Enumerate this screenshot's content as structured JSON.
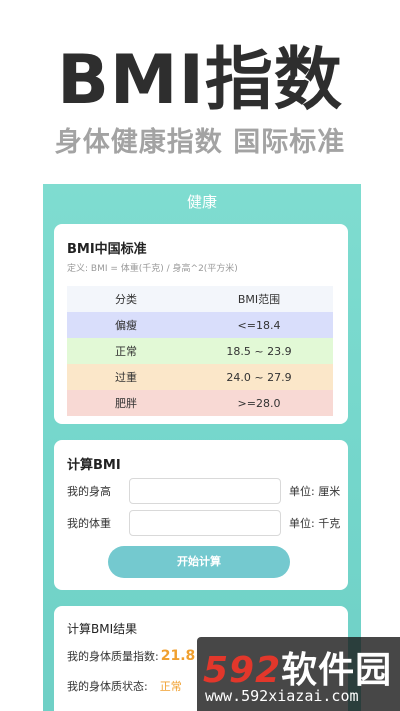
{
  "hero": {
    "title": "BMI指数",
    "subtitle": "身体健康指数 国际标准"
  },
  "app": {
    "header": "健康",
    "standard_card": {
      "title": "BMI中国标准",
      "definition": "定义: BMI = 体重(千克) / 身高^2(平方米)",
      "columns": [
        "分类",
        "BMI范围"
      ],
      "rows": [
        {
          "category": "偏瘦",
          "range": "<=18.4",
          "color": "#d9defb"
        },
        {
          "category": "正常",
          "range": "18.5 ~ 23.9",
          "color": "#e2f9d6"
        },
        {
          "category": "过重",
          "range": "24.0 ~ 27.9",
          "color": "#fbe7c9"
        },
        {
          "category": "肥胖",
          "range": ">=28.0",
          "color": "#f8d9d4"
        }
      ],
      "header_color": "#f3f6fb"
    },
    "calc_card": {
      "title": "计算BMI",
      "height_label": "我的身高",
      "height_value": "",
      "height_unit": "单位: 厘米",
      "weight_label": "我的体重",
      "weight_value": "",
      "weight_unit": "单位: 千克",
      "button": "开始计算"
    },
    "result_card": {
      "title": "计算BMI结果",
      "bmi_label": "我的身体质量指数:",
      "bmi_value": "21.8",
      "status_label": "我的身体质状态:",
      "status_value": "正常"
    }
  },
  "watermark": {
    "logo_num": "592",
    "logo_text": "软件园",
    "url": "www.592xiazai.com"
  },
  "colors": {
    "accent": "#74c9cf",
    "teal_bg": "#7fdcd0",
    "highlight": "#f0a030"
  }
}
